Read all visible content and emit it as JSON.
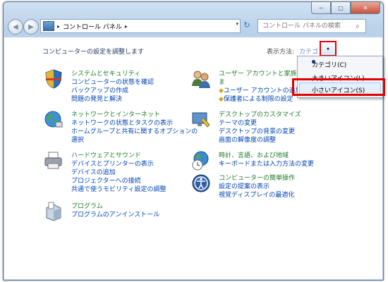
{
  "window": {
    "caption_buttons": {
      "minimize": "─",
      "maximize": "□",
      "close": "✕"
    }
  },
  "nav": {
    "back_glyph": "◀",
    "forward_glyph": "▶",
    "address": {
      "crumbs": [
        "コントロール パネル"
      ],
      "separator": "▸",
      "dropdown": "▾"
    },
    "refresh_glyph": "↻",
    "search_placeholder": "コントロール パネルの検索",
    "search_glyph": "⌕"
  },
  "content": {
    "heading": "コンピューターの設定を調整します",
    "view_by_label": "表示方法:",
    "view_by_value": "カテゴリ",
    "view_by_arrow": "▾"
  },
  "categories": {
    "system": {
      "title": "システムとセキュリティ",
      "links": [
        "コンピューターの状態を確認",
        "バックアップの作成",
        "問題の発見と解決"
      ]
    },
    "network": {
      "title": "ネットワークとインターネット",
      "links": [
        "ネットワークの状態とタスクの表示",
        "ホームグループと共有に関するオプションの",
        "選択"
      ]
    },
    "hardware": {
      "title": "ハードウェアとサウンド",
      "links": [
        "デバイスとプリンターの表示",
        "デバイスの追加",
        "プロジェクターへの接続",
        "共通で使うモビリティ設定の調整"
      ]
    },
    "programs": {
      "title": "プログラム",
      "links": [
        "プログラムのアンインストール"
      ]
    },
    "users": {
      "title": "ユーザー アカウントと家族のた",
      "title_cont": "ま",
      "links": [
        "ユーザー アカウントの追加",
        "保護者による制限の設定"
      ]
    },
    "appearance": {
      "title": "デスクトップのカスタマイズ",
      "links": [
        "テーマの変更",
        "デスクトップの背景の変更",
        "画面の解像度の調整"
      ]
    },
    "clock": {
      "title": "時計、言語、および地域",
      "links": [
        "キーボードまたは入力方法の変更"
      ]
    },
    "ease": {
      "title": "コンピューターの簡単操作",
      "links": [
        "設定の提案の表示",
        "視覚ディスプレイの最適化"
      ]
    }
  },
  "menu": {
    "items": [
      {
        "label": "カテゴリ(C)",
        "selected": true
      },
      {
        "label": "大きいアイコン(L)",
        "selected": false
      },
      {
        "label": "小さいアイコン(S)",
        "selected": false,
        "highlighted": true
      }
    ]
  },
  "colors": {
    "link": "#0044b3",
    "category_title": "#1f7a29",
    "highlight": "#e20000"
  }
}
